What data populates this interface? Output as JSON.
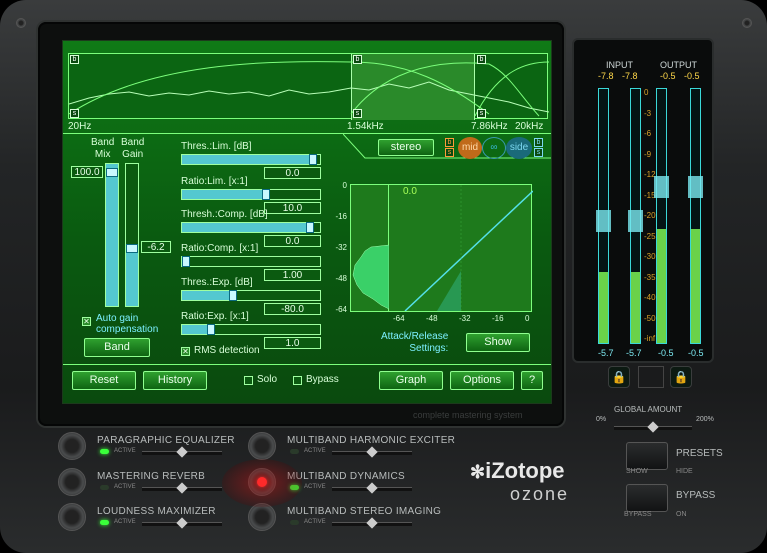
{
  "spectrum": {
    "freq_labels": [
      "20Hz",
      "1.54kHz",
      "7.86kHz",
      "20kHz"
    ],
    "band_marker_top": "b",
    "band_marker_bottom": "s"
  },
  "band_controls": {
    "band_mix_label": "Band\nMix",
    "band_gain_label": "Band\nGain",
    "band_mix_value": "100.0",
    "band_gain_value": "-6.2",
    "band_mix_level": 1.0,
    "auto_gain_label": "Auto gain\ncompensation",
    "auto_gain_checked": true,
    "band_button": "Band"
  },
  "params": [
    {
      "label": "Thres.:Lim. [dB]",
      "value": "0.0",
      "fill": 0.98
    },
    {
      "label": "Ratio:Lim. [x:1]",
      "value": "10.0",
      "fill": 0.64
    },
    {
      "label": "Thresh.:Comp. [dB]",
      "value": "0.0",
      "fill": 0.96
    },
    {
      "label": "Ratio:Comp. [x:1]",
      "value": "1.00",
      "fill": 0.05
    },
    {
      "label": "Thres.:Exp. [dB]",
      "value": "-80.0",
      "fill": 0.4
    },
    {
      "label": "Ratio:Exp. [x:1]",
      "value": "1.0",
      "fill": 0.24
    }
  ],
  "rms_label": "RMS detection",
  "rms_checked": true,
  "stereo_button": "stereo",
  "mid_label": "mid",
  "side_label": "side",
  "graph": {
    "y_ticks": [
      "0",
      "-16",
      "-32",
      "-48",
      "-64"
    ],
    "x_ticks": [
      "-64",
      "-48",
      "-32",
      "-16",
      "0"
    ],
    "readout": "0.0"
  },
  "attack_label": "Attack/Release\nSettings:",
  "show_button": "Show",
  "bottom_buttons": {
    "reset": "Reset",
    "history": "History",
    "solo": "Solo",
    "bypass": "Bypass",
    "graph": "Graph",
    "options": "Options",
    "help": "?"
  },
  "tagline": "complete mastering system",
  "meters": {
    "input_label": "INPUT",
    "output_label": "OUTPUT",
    "input_peak": [
      "-7.8",
      "-7.8"
    ],
    "output_peak": [
      "-0.5",
      "-0.5"
    ],
    "input_bottom": [
      "-5.7",
      "-5.7"
    ],
    "output_bottom": [
      "-0.5",
      "-0.5"
    ],
    "scale": [
      "0",
      "-3",
      "-6",
      "-9",
      "-12",
      "-15",
      "-20",
      "-25",
      "-30",
      "-35",
      "-40",
      "-50",
      "-inf"
    ],
    "input_level": 0.28,
    "output_level": 0.45
  },
  "global_amount": {
    "label": "GLOBAL AMOUNT",
    "min": "0%",
    "max": "200%",
    "value": 0.5
  },
  "modules": [
    {
      "name": "PARAGRAPHIC EQUALIZER",
      "status": "ACTIVE",
      "on": true
    },
    {
      "name": "MASTERING REVERB",
      "status": "ACTIVE",
      "on": false
    },
    {
      "name": "LOUDNESS MAXIMIZER",
      "status": "ACTIVE",
      "on": true
    },
    {
      "name": "MULTIBAND HARMONIC EXCITER",
      "status": "ACTIVE",
      "on": false
    },
    {
      "name": "MULTIBAND DYNAMICS",
      "status": "ACTIVE",
      "on": true
    },
    {
      "name": "MULTIBAND STEREO IMAGING",
      "status": "ACTIVE",
      "on": false
    }
  ],
  "logo": {
    "brand": "iZotope",
    "product": "ozone"
  },
  "presets": {
    "label": "PRESETS",
    "show": "SHOW",
    "hide": "HIDE"
  },
  "bypass": {
    "label": "BYPASS",
    "bypass": "BYPASS",
    "on": "ON"
  },
  "colors": {
    "screen": "#0a5a10",
    "accent": "#7cff7c",
    "meter": "#3ad8d8",
    "warning": "#ffd84a"
  }
}
